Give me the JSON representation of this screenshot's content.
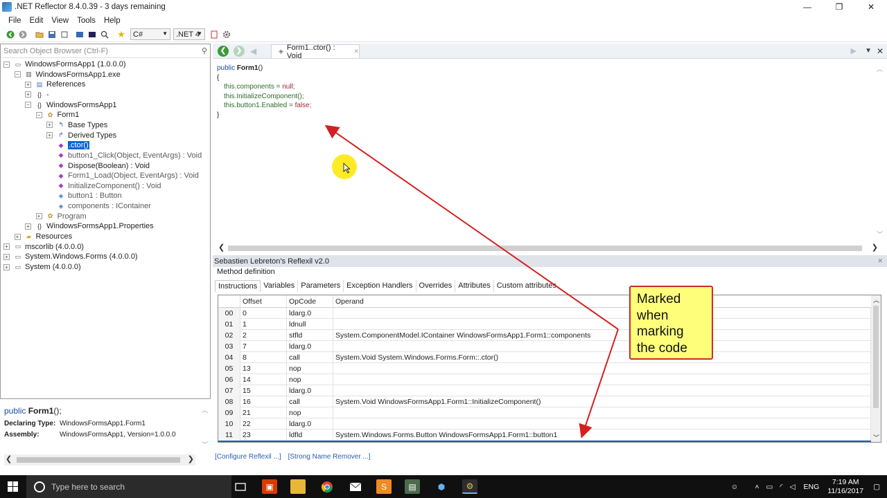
{
  "window": {
    "title": ".NET Reflector 8.4.0.39 - 3 days remaining",
    "min": "—",
    "max": "❐",
    "close": "✕"
  },
  "menu": [
    "File",
    "Edit",
    "View",
    "Tools",
    "Help"
  ],
  "toolbar": {
    "language": "C#",
    "framework": ".NET 4"
  },
  "browser": {
    "search_placeholder": "Search Object Browser (Ctrl-F)",
    "tree": [
      {
        "label": "WindowsFormsApp1 (1.0.0.0)",
        "depth": 0,
        "exp": "−",
        "icon": "assembly-icon"
      },
      {
        "label": "WindowsFormsApp1.exe",
        "depth": 1,
        "exp": "−",
        "icon": "module-icon"
      },
      {
        "label": "References",
        "depth": 2,
        "exp": "+",
        "icon": "references-icon"
      },
      {
        "label": "-",
        "depth": 2,
        "exp": "+",
        "icon": "namespace-icon"
      },
      {
        "label": "WindowsFormsApp1",
        "depth": 2,
        "exp": "−",
        "icon": "namespace-icon"
      },
      {
        "label": "Form1",
        "depth": 3,
        "exp": "−",
        "icon": "class-icon"
      },
      {
        "label": "Base Types",
        "depth": 4,
        "exp": "+",
        "icon": "base-types-icon"
      },
      {
        "label": "Derived Types",
        "depth": 4,
        "exp": "+",
        "icon": "derived-types-icon"
      },
      {
        "label": ".ctor()",
        "depth": 4,
        "exp": "",
        "icon": "method-icon",
        "selected": true
      },
      {
        "label": "button1_Click(Object, EventArgs) : Void",
        "depth": 4,
        "exp": "",
        "icon": "method-icon",
        "gray": true
      },
      {
        "label": "Dispose(Boolean) : Void",
        "depth": 4,
        "exp": "",
        "icon": "method-icon"
      },
      {
        "label": "Form1_Load(Object, EventArgs) : Void",
        "depth": 4,
        "exp": "",
        "icon": "method-icon",
        "gray": true
      },
      {
        "label": "InitializeComponent() : Void",
        "depth": 4,
        "exp": "",
        "icon": "method-icon",
        "gray": true
      },
      {
        "label": "button1 : Button",
        "depth": 4,
        "exp": "",
        "icon": "field-icon",
        "gray": true
      },
      {
        "label": "components : IContainer",
        "depth": 4,
        "exp": "",
        "icon": "field-icon",
        "gray": true
      },
      {
        "label": "Program",
        "depth": 3,
        "exp": "+",
        "icon": "class-icon",
        "gray": true
      },
      {
        "label": "WindowsFormsApp1.Properties",
        "depth": 2,
        "exp": "+",
        "icon": "namespace-icon"
      },
      {
        "label": "Resources",
        "depth": 1,
        "exp": "+",
        "icon": "folder-icon"
      },
      {
        "label": "mscorlib (4.0.0.0)",
        "depth": 0,
        "exp": "+",
        "icon": "assembly-icon"
      },
      {
        "label": "System.Windows.Forms (4.0.0.0)",
        "depth": 0,
        "exp": "+",
        "icon": "assembly-icon"
      },
      {
        "label": "System (4.0.0.0)",
        "depth": 0,
        "exp": "+",
        "icon": "assembly-icon"
      }
    ]
  },
  "info": {
    "sig_kw": "public",
    "sig_name": "Form1",
    "sig_rest": "();",
    "declaring_label": "Declaring Type:",
    "declaring_value": "WindowsFormsApp1.Form1",
    "assembly_label": "Assembly:",
    "assembly_value": "WindowsFormsApp1, Version=1.0.0.0"
  },
  "editor": {
    "tab_label": "Form1..ctor() : Void",
    "code": {
      "l1_kw": "public",
      "l1_name": "Form1",
      "l1_rest": "()",
      "l2": "{",
      "l3_a": "this.components = ",
      "l3_b": "null",
      "l3_c": ";",
      "l4": "this.InitializeComponent();",
      "l5_a": "this.button1.Enabled = ",
      "l5_b": "false",
      "l5_c": ";",
      "l6": "}"
    }
  },
  "reflexil": {
    "title": "Sebastien Lebreton's Reflexil v2.0",
    "section": "Method definition",
    "tabs": [
      "Instructions",
      "Variables",
      "Parameters",
      "Exception Handlers",
      "Overrides",
      "Attributes",
      "Custom attributes"
    ],
    "columns": [
      "",
      "Offset",
      "OpCode",
      "Operand"
    ],
    "rows": [
      [
        "00",
        "0",
        "ldarg.0",
        ""
      ],
      [
        "01",
        "1",
        "ldnull",
        ""
      ],
      [
        "02",
        "2",
        "stfld",
        "System.ComponentModel.IContainer WindowsFormsApp1.Form1::components"
      ],
      [
        "03",
        "7",
        "ldarg.0",
        ""
      ],
      [
        "04",
        "8",
        "call",
        "System.Void System.Windows.Forms.Form::.ctor()"
      ],
      [
        "05",
        "13",
        "nop",
        ""
      ],
      [
        "06",
        "14",
        "nop",
        ""
      ],
      [
        "07",
        "15",
        "ldarg.0",
        ""
      ],
      [
        "08",
        "16",
        "call",
        "System.Void WindowsFormsApp1.Form1::InitializeComponent()"
      ],
      [
        "09",
        "21",
        "nop",
        ""
      ],
      [
        "10",
        "22",
        "ldarg.0",
        ""
      ],
      [
        "11",
        "23",
        "ldfld",
        "System.Windows.Forms.Button WindowsFormsApp1.Form1::button1"
      ]
    ],
    "links": [
      "[Configure Reflexil ...]",
      "[Strong Name Remover ...]"
    ]
  },
  "annotation": {
    "text": "Marked when marking the code",
    "lines": [
      "Marked",
      "when",
      "marking",
      "the code"
    ]
  },
  "taskbar": {
    "search_placeholder": "Type here to search",
    "lang": "ENG",
    "time": "7:19 AM",
    "date": "11/16/2017"
  }
}
